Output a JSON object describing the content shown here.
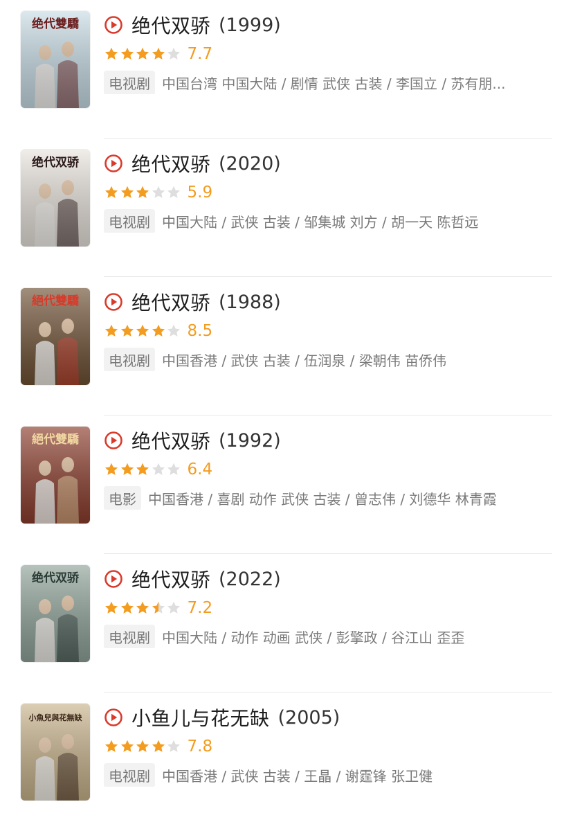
{
  "colors": {
    "accent_red": "#d93a2b",
    "star_filled": "#f39c1f",
    "star_empty": "#dedede",
    "score": "#f39c1f"
  },
  "icons": {
    "play": "play-circle-icon",
    "star": "star-icon"
  },
  "results": [
    {
      "title": "绝代双骄",
      "year": "(1999)",
      "stars": 4,
      "score": "7.7",
      "type": "电视剧",
      "meta": "中国台湾 中国大陆 / 剧情 武侠 古装 / 李国立 / 苏有朋...",
      "poster_text": "绝代雙驕",
      "poster_bg": "#c8dde6",
      "poster_fg": "#6b1d1d"
    },
    {
      "title": "绝代双骄",
      "year": "(2020)",
      "stars": 3,
      "score": "5.9",
      "type": "电视剧",
      "meta": "中国大陆 / 武侠 古装 / 邹集城 刘方 / 胡一天 陈哲远",
      "poster_text": "绝代双骄",
      "poster_bg": "#e9e3dc",
      "poster_fg": "#2b1a1a"
    },
    {
      "title": "绝代双骄",
      "year": "(1988)",
      "stars": 4,
      "score": "8.5",
      "type": "电视剧",
      "meta": "中国香港 / 武侠 古装 / 伍润泉 / 梁朝伟 苗侨伟",
      "poster_text": "絕代雙驕",
      "poster_bg": "#6e5134",
      "poster_fg": "#d83a2a"
    },
    {
      "title": "绝代双骄",
      "year": "(1992)",
      "stars": 3,
      "score": "6.4",
      "type": "电影",
      "meta": "中国香港 / 喜剧 动作 武侠 古装 / 曾志伟 / 刘德华 林青霞",
      "poster_text": "絕代雙驕",
      "poster_bg": "#8c3d2d",
      "poster_fg": "#f0d6a0"
    },
    {
      "title": "绝代双骄",
      "year": "(2022)",
      "stars": 3.5,
      "score": "7.2",
      "type": "电视剧",
      "meta": "中国大陆 / 动作 动画 武侠 / 彭擎政 / 谷江山 歪歪",
      "poster_text": "绝代双骄",
      "poster_bg": "#8fa39a",
      "poster_fg": "#2c3a36"
    },
    {
      "title": "小鱼儿与花无缺",
      "year": "(2005)",
      "stars": 4,
      "score": "7.8",
      "type": "电视剧",
      "meta": "中国香港 / 武侠 古装 / 王晶 / 谢霆锋 张卫健",
      "poster_text": "小魚兒與花無缺",
      "poster_bg": "#c9b48c",
      "poster_fg": "#3a2418"
    }
  ]
}
